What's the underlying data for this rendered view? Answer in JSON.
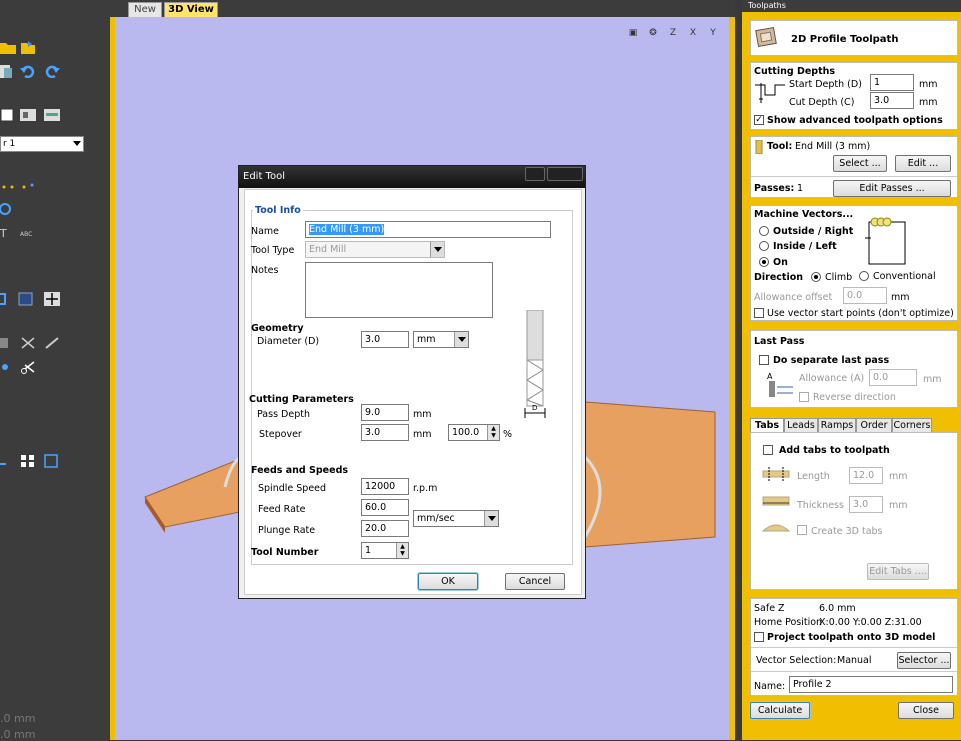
{
  "left_panel": {
    "layer_select": "r 1",
    "readouts": [
      ".0 mm",
      ".0 mm"
    ]
  },
  "view_tabs": [
    "New",
    "3D View"
  ],
  "view_icons": [
    "zoom-extents-icon",
    "iso-view-icon",
    "view-z-icon",
    "view-x-icon",
    "view-y-icon"
  ],
  "dialog": {
    "title": "Edit Tool",
    "tool_info": {
      "heading": "Tool Info",
      "name_label": "Name",
      "name_value": "End Mill (3 mm)",
      "type_label": "Tool Type",
      "type_value": "End Mill",
      "notes_label": "Notes",
      "notes_value": ""
    },
    "geometry": {
      "heading": "Geometry",
      "diameter_label": "Diameter (D)",
      "diameter_value": "3.0",
      "units": "mm",
      "diagram_label": "D"
    },
    "cutting": {
      "heading": "Cutting Parameters",
      "pass_depth_label": "Pass Depth",
      "pass_depth_value": "9.0",
      "pass_depth_unit": "mm",
      "stepover_label": "Stepover",
      "stepover_value": "3.0",
      "stepover_unit": "mm",
      "stepover_percent": "100.0",
      "percent_sign": "%"
    },
    "feeds": {
      "heading": "Feeds and Speeds",
      "spindle_label": "Spindle Speed",
      "spindle_value": "12000",
      "spindle_unit": "r.p.m",
      "feed_label": "Feed Rate",
      "feed_value": "60.0",
      "plunge_label": "Plunge Rate",
      "plunge_value": "20.0",
      "rate_unit": "mm/sec"
    },
    "tool_number_label": "Tool Number",
    "tool_number_value": "1",
    "ok": "OK",
    "cancel": "Cancel"
  },
  "toolpaths": {
    "panel_title": "Toolpaths",
    "header": "2D Profile Toolpath",
    "depths": {
      "heading": "Cutting Depths",
      "start_label": "Start Depth (D)",
      "start_value": "1",
      "cut_label": "Cut Depth (C)",
      "cut_value": "3.0",
      "unit": "mm",
      "advanced_label": "Show advanced toolpath options",
      "advanced_checked": true
    },
    "tool": {
      "label": "Tool:",
      "value": "End Mill (3 mm)",
      "select_btn": "Select ...",
      "edit_btn": "Edit ...",
      "passes_label": "Passes:",
      "passes_value": "1",
      "edit_passes_btn": "Edit Passes ..."
    },
    "machine": {
      "heading": "Machine Vectors...",
      "outside": "Outside / Right",
      "inside": "Inside / Left",
      "on": "On",
      "direction_label": "Direction",
      "climb": "Climb",
      "conventional": "Conventional",
      "allowance_label": "Allowance offset",
      "allowance_value": "0.0",
      "allowance_unit": "mm",
      "vector_start_label": "Use vector start points (don't optimize)"
    },
    "last_pass": {
      "heading": "Last Pass",
      "separate_label": "Do separate last pass",
      "allowance_label": "Allowance (A)",
      "allowance_value": "0.0",
      "unit": "mm",
      "reverse_label": "Reverse direction"
    },
    "tabs": {
      "tab_labels": [
        "Tabs",
        "Leads",
        "Ramps",
        "Order",
        "Corners"
      ],
      "add_label": "Add tabs to toolpath",
      "length_label": "Length",
      "length_value": "12.0",
      "thickness_label": "Thickness",
      "thickness_value": "3.0",
      "unit": "mm",
      "create3d_label": "Create 3D tabs",
      "edit_btn": "Edit Tabs ...."
    },
    "info": {
      "safez_label": "Safe Z",
      "safez_value": "6.0 mm",
      "home_label": "Home Position",
      "home_value": "X:0.00 Y:0.00 Z:31.00",
      "project_label": "Project toolpath onto 3D model",
      "vector_sel_label": "Vector Selection:",
      "vector_sel_value": "Manual",
      "selector_btn": "Selector ...",
      "name_label": "Name:",
      "name_value": "Profile 2"
    },
    "calculate": "Calculate",
    "close": "Close"
  }
}
